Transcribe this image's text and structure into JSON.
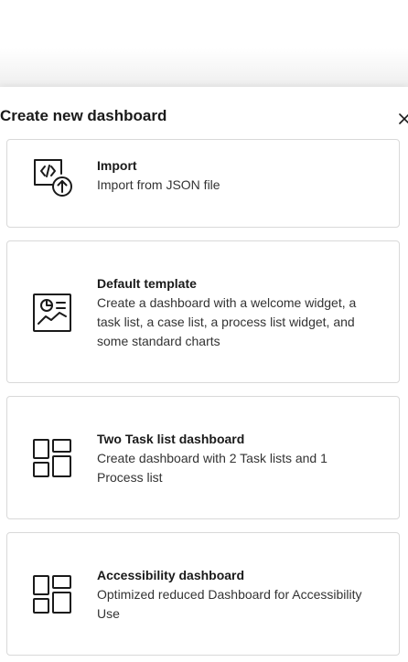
{
  "dialog": {
    "title": "Create new dashboard",
    "close_icon": "close-icon"
  },
  "options": [
    {
      "title": "Import",
      "description": "Import from JSON file",
      "icon": "import-json-icon"
    },
    {
      "title": "Default template",
      "description": "Create a dashboard with a welcome widget, a task list, a case list, a process list widget, and some standard charts",
      "icon": "chart-template-icon"
    },
    {
      "title": "Two Task list dashboard",
      "description": "Create dashboard with 2 Task lists and 1 Process list",
      "icon": "dashboard-layout-icon"
    },
    {
      "title": "Accessibility dashboard",
      "description": "Optimized reduced Dashboard for Accessibility Use",
      "icon": "dashboard-layout-icon"
    }
  ],
  "colors": {
    "card_border": "#d9d9d9",
    "icon_stroke": "#1a1a1a",
    "text": "#1a1a1a"
  }
}
